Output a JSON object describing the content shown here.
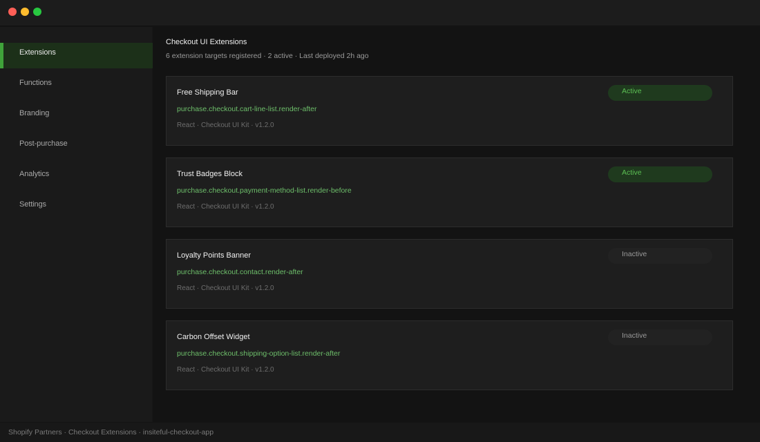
{
  "window": {
    "controls": [
      "close",
      "minimize",
      "maximize"
    ]
  },
  "sidebar": {
    "items": [
      {
        "label": "Extensions",
        "active": true
      },
      {
        "label": "Functions",
        "active": false
      },
      {
        "label": "Branding",
        "active": false
      },
      {
        "label": "Post-purchase",
        "active": false
      },
      {
        "label": "Analytics",
        "active": false
      },
      {
        "label": "Settings",
        "active": false
      }
    ]
  },
  "main": {
    "title": "Checkout UI Extensions",
    "subtitle": "6 extension targets registered · 2 active · Last deployed 2h ago",
    "extensions": [
      {
        "name": "Free Shipping Bar",
        "target": "purchase.checkout.cart-line-list.render-after",
        "meta": "React · Checkout UI Kit · v1.2.0",
        "status": "Active"
      },
      {
        "name": "Trust Badges Block",
        "target": "purchase.checkout.payment-method-list.render-before",
        "meta": "React · Checkout UI Kit · v1.2.0",
        "status": "Active"
      },
      {
        "name": "Loyalty Points Banner",
        "target": "purchase.checkout.contact.render-after",
        "meta": "React · Checkout UI Kit · v1.2.0",
        "status": "Inactive"
      },
      {
        "name": "Carbon Offset Widget",
        "target": "purchase.checkout.shipping-option-list.render-after",
        "meta": "React · Checkout UI Kit · v1.2.0",
        "status": "Inactive"
      }
    ]
  },
  "statusbar": {
    "text": "Shopify Partners · Checkout Extensions · insiteful-checkout-app"
  },
  "colors": {
    "accent": "#3fa33a",
    "active_badge_bg": "#1f3a1e",
    "active_badge_text": "#5cc054",
    "target_text": "#6dbe6a"
  }
}
